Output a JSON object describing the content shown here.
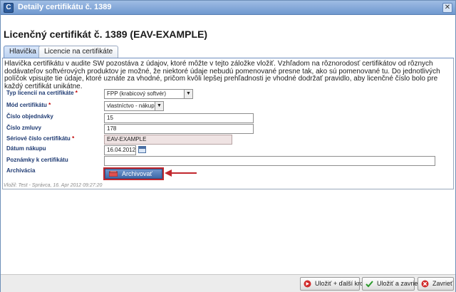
{
  "window": {
    "title": "Detaily certifikátu č. 1389",
    "app_icon": "C",
    "close_label": "✕"
  },
  "page_title": "Licenčný certifikát č. 1389 (EAV-EXAMPLE)",
  "tabs": [
    {
      "label": "Hlavička",
      "active": true
    },
    {
      "label": "Licencie na certifikáte",
      "active": false
    }
  ],
  "intro_text": "Hlavička certifikátu v audite SW pozostáva z údajov, ktoré môžte v tejto záložke vložiť. Vzhľadom na rôznorodosť certifikátov od rôznych dodávateľov softvérových produktov je možné, že niektoré údaje nebudú pomenované presne tak, ako sú pomenované tu. Do jednotlivých políčok vpisujte tie údaje, ktoré uznáte za vhodné, pričom kvôli lepšej prehľadnosti je vhodné dodržať pravidlo, aby licenčné číslo bolo pre každý certifikát unikátne.",
  "form": {
    "license_type": {
      "label": "Typ licencií na certifikáte",
      "required": "*",
      "value": "FPP (krabicový softvér)"
    },
    "cert_mode": {
      "label": "Mód certifikátu",
      "required": "*",
      "value": "vlastníctvo - nákup"
    },
    "order_number": {
      "label": "Číslo objednávky",
      "value": "15"
    },
    "contract_number": {
      "label": "Číslo zmluvy",
      "value": "178"
    },
    "serial_number": {
      "label": "Sériové číslo certifikátu",
      "required": "*",
      "value": "EAV-EXAMPLE"
    },
    "purchase_date": {
      "label": "Dátum nákupu",
      "value": "16.04.2012"
    },
    "notes": {
      "label": "Poznámky k certifikátu",
      "value": ""
    },
    "archive": {
      "label": "Archivácia",
      "button_label": "Archivovať"
    }
  },
  "footnote": "Vložil: Test - Správca, 16. Apr 2012 09:27:20",
  "buttons": {
    "save_next": "Uložiť + ďalší krok",
    "save_close": "Uložiť a zavrieť",
    "close": "Zavrieť"
  },
  "colors": {
    "accent": "#3f6aa8",
    "highlight": "#c1272d",
    "label": "#1f3b73"
  }
}
